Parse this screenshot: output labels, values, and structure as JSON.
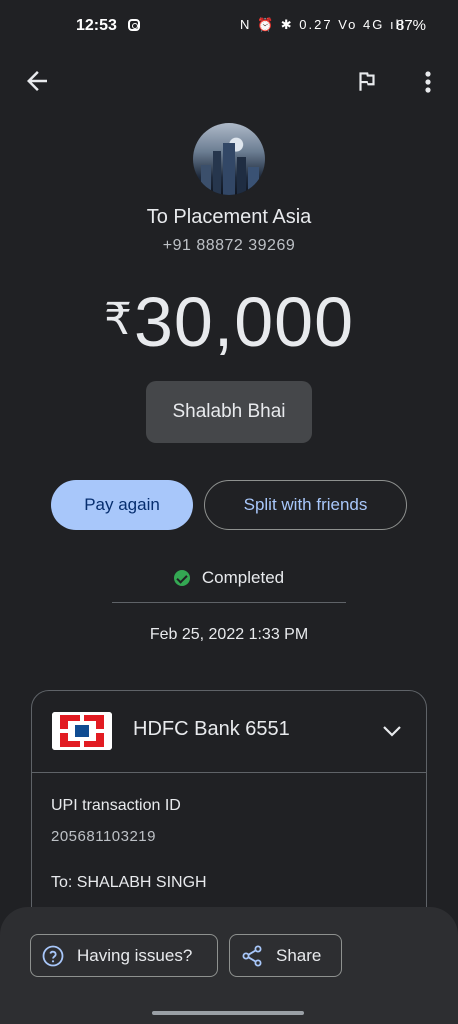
{
  "status_bar": {
    "time": "12:53",
    "system": "N ⏰ ✱ 0.27 Vo 4G ıll",
    "battery": "87%"
  },
  "payee": {
    "name": "To Placement Asia",
    "phone": "+91 88872 39269"
  },
  "amount": {
    "currency": "₹",
    "value": "30,000"
  },
  "note": "Shalabh Bhai",
  "actions": {
    "pay_again": "Pay again",
    "split": "Split with friends"
  },
  "transaction": {
    "status": "Completed",
    "datetime": "Feb 25, 2022 1:33 PM"
  },
  "details": {
    "bank": "HDFC Bank 6551",
    "upi_label": "UPI transaction ID",
    "upi_id": "205681103219",
    "to": "To: SHALABH SINGH"
  },
  "bottom_sheet": {
    "issues": "Having issues?",
    "share": "Share"
  },
  "colors": {
    "background": "#202124",
    "accent": "#a8c7fa",
    "success": "#34a853"
  }
}
